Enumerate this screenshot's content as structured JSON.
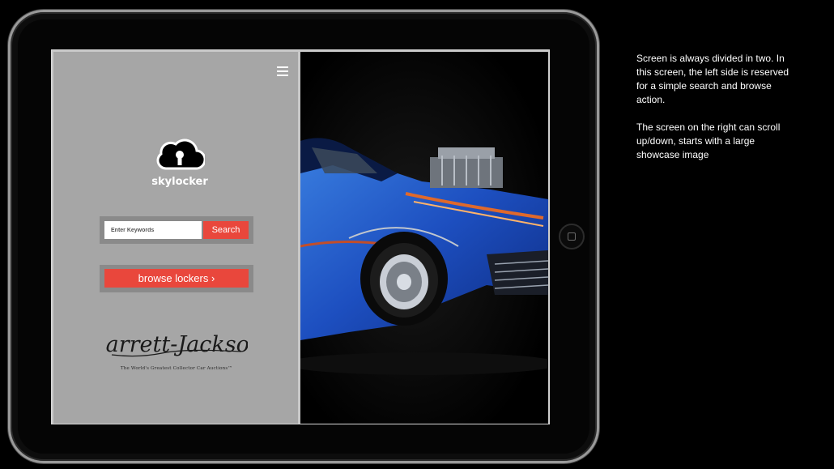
{
  "app": {
    "name": "skylocker"
  },
  "left_panel": {
    "search": {
      "placeholder": "Enter Keywords",
      "button_label": "Search"
    },
    "browse_button_label": "browse lockers ›",
    "partner": {
      "logo_text": "Barrett-Jackson",
      "tagline": "The World's Greatest Collector Car Auctions™"
    }
  },
  "right_panel": {
    "image": "showcase-car-blue-corvette"
  },
  "annotation": {
    "paragraph_1": "Screen is always divided in two. In this screen, the left side is reserved for a simple search and browse action.",
    "paragraph_2": "The screen on the right can scroll up/down, starts with a large showcase image"
  },
  "colors": {
    "accent_red": "#e9473c",
    "left_panel_bg": "#a6a6a6",
    "background": "#000000"
  }
}
